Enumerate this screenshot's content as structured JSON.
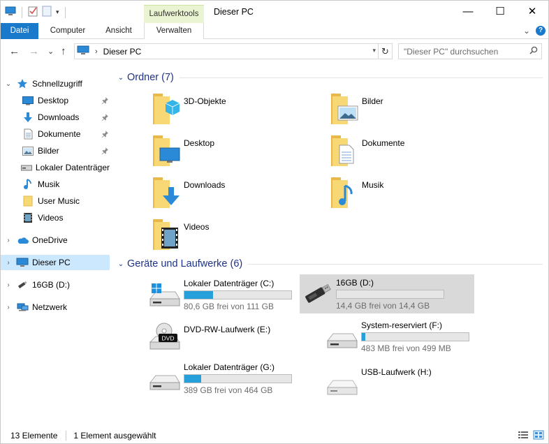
{
  "window": {
    "title": "Dieser PC",
    "context_tab_top": "Laufwerktools",
    "controls": {
      "minimize": "—",
      "maximize": "☐",
      "close": "✕"
    }
  },
  "ribbon": {
    "tabs": [
      "Datei",
      "Computer",
      "Ansicht",
      "Verwalten"
    ],
    "expand_glyph": "⌄",
    "help_glyph": "?"
  },
  "nav": {
    "back_glyph": "←",
    "forward_glyph": "→",
    "recent_glyph": "⌄",
    "up_glyph": "↑",
    "breadcrumb_sep": "›",
    "path": "Dieser PC",
    "dropdown_glyph": "▾",
    "refresh_glyph": "↻",
    "search_placeholder": "\"Dieser PC\" durchsuchen"
  },
  "navpane": {
    "quick_access": "Schnellzugriff",
    "items": [
      {
        "label": "Desktop",
        "icon": "desktop-icon",
        "pinned": true
      },
      {
        "label": "Downloads",
        "icon": "downloads-icon",
        "pinned": true
      },
      {
        "label": "Dokumente",
        "icon": "documents-icon",
        "pinned": true
      },
      {
        "label": "Bilder",
        "icon": "pictures-icon",
        "pinned": true
      },
      {
        "label": "Lokaler Datenträger",
        "icon": "drive-icon",
        "pinned": false
      },
      {
        "label": "Musik",
        "icon": "music-icon",
        "pinned": false
      },
      {
        "label": "User Music",
        "icon": "folder-icon",
        "pinned": false
      },
      {
        "label": "Videos",
        "icon": "videos-icon",
        "pinned": false
      }
    ],
    "onedrive": "OneDrive",
    "this_pc": "Dieser PC",
    "usb": "16GB (D:)",
    "network": "Netzwerk"
  },
  "content": {
    "folders_header": "Ordner (7)",
    "folders": [
      "3D-Objekte",
      "Bilder",
      "Desktop",
      "Dokumente",
      "Downloads",
      "Musik",
      "Videos"
    ],
    "devices_header": "Geräte und Laufwerke (6)",
    "drives": [
      {
        "name": "Lokaler Datenträger (C:)",
        "free": "80,6 GB frei von 111 GB",
        "used_fraction": 0.27,
        "bar": true,
        "icon": "windows-drive-icon"
      },
      {
        "name": "16GB (D:)",
        "free": "14,4 GB frei von 14,4 GB",
        "used_fraction": 0.0,
        "bar": true,
        "icon": "usb-stick-icon",
        "selected": true
      },
      {
        "name": "DVD-RW-Laufwerk (E:)",
        "free": "",
        "used_fraction": null,
        "bar": false,
        "icon": "dvd-drive-icon"
      },
      {
        "name": "System-reserviert (F:)",
        "free": "483 MB frei von 499 MB",
        "used_fraction": 0.03,
        "bar": true,
        "icon": "drive-icon"
      },
      {
        "name": "Lokaler Datenträger (G:)",
        "free": "389 GB frei von 464 GB",
        "used_fraction": 0.16,
        "bar": true,
        "icon": "drive-icon"
      },
      {
        "name": "USB-Laufwerk (H:)",
        "free": "",
        "used_fraction": null,
        "bar": false,
        "icon": "usb-drive-icon"
      }
    ],
    "dvd_label": "DVD"
  },
  "status": {
    "count": "13 Elemente",
    "selection": "1 Element ausgewählt"
  },
  "colors": {
    "accent": "#1979ca",
    "group_header": "#1e3287",
    "selection": "#cce8ff",
    "bar_fill": "#26a0da",
    "folder_yellow": "#f8d775"
  }
}
